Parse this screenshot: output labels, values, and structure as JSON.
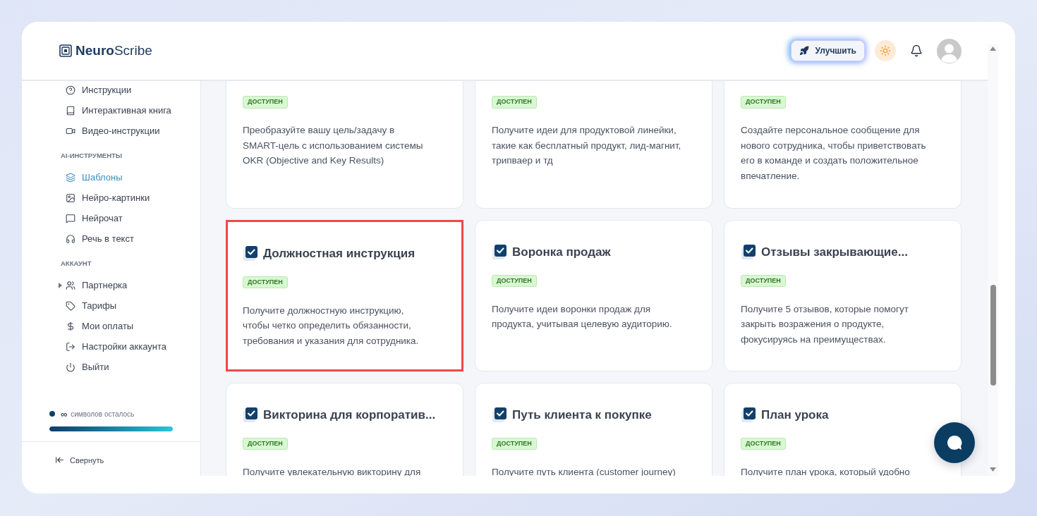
{
  "brand": {
    "bold": "Neuro",
    "rest": "Scribe"
  },
  "header": {
    "upgrade": "Улучшить"
  },
  "sidebar": {
    "sections": [
      {
        "items": [
          {
            "label": "Инструкции",
            "selected": false
          },
          {
            "label": "Интерактивная книга",
            "selected": false
          },
          {
            "label": "Видео-инструкции",
            "selected": false
          }
        ]
      },
      {
        "heading": "AI-ИНСТРУМЕНТЫ",
        "items": [
          {
            "label": "Шаблоны",
            "selected": true
          },
          {
            "label": "Нейро-картинки",
            "selected": false
          },
          {
            "label": "Нейрочат",
            "selected": false
          },
          {
            "label": "Речь в текст",
            "selected": false
          }
        ]
      },
      {
        "heading": "АККАУНТ",
        "items": [
          {
            "label": "Партнерка",
            "selected": false,
            "expanded": false
          },
          {
            "label": "Тарифы",
            "selected": false
          },
          {
            "label": "Мои оплаты",
            "selected": false
          },
          {
            "label": "Настройки аккаунта",
            "selected": false
          },
          {
            "label": "Выйти",
            "selected": false
          }
        ]
      }
    ],
    "credits": {
      "amount": "∞",
      "label": "символов осталось",
      "level": 1
    },
    "collapse": "Свернуть"
  },
  "cards": [
    {
      "badge": "ДОСТУПЕН",
      "description": "Преобразуйте вашу цель/задачу в SMART-цель с использованием системы OKR (Objective and Key Results)",
      "highlighted": false
    },
    {
      "badge": "ДОСТУПЕН",
      "description": "Получите идеи для продуктовой линейки, такие как бесплатный продукт, лид-магнит, трипваер и тд",
      "highlighted": false
    },
    {
      "badge": "ДОСТУПЕН",
      "description": "Создайте персональное сообщение для нового сотрудника, чтобы приветствовать его в команде и создать положительное впечатление.",
      "highlighted": false
    },
    {
      "title": "Должностная инструкция",
      "badge": "ДОСТУПЕН",
      "description": "Получите должностную инструкцию, чтобы четко определить обязанности, требования и указания для сотрудника.",
      "highlighted": true
    },
    {
      "title": "Воронка продаж",
      "badge": "ДОСТУПЕН",
      "description": "Получите идеи воронки продаж для продукта, учитывая целевую аудиторию.",
      "highlighted": false
    },
    {
      "title": "Отзывы закрывающие...",
      "badge": "ДОСТУПЕН",
      "description": "Получите 5 отзывов, которые помогут закрыть возражения о продукте, фокусируясь на преимуществах.",
      "highlighted": false
    },
    {
      "title": "Викторина для корпоратив...",
      "badge": "ДОСТУПЕН",
      "description": "Получите увлекательную викторину для",
      "highlighted": false
    },
    {
      "title": "Путь клиента к покупке",
      "badge": "ДОСТУПЕН",
      "description": "Получите путь клиента (customer journey)",
      "highlighted": false
    },
    {
      "title": "План урока",
      "badge": "ДОСТУПЕН",
      "description": "Получите план урока, который удобно",
      "highlighted": false
    }
  ]
}
